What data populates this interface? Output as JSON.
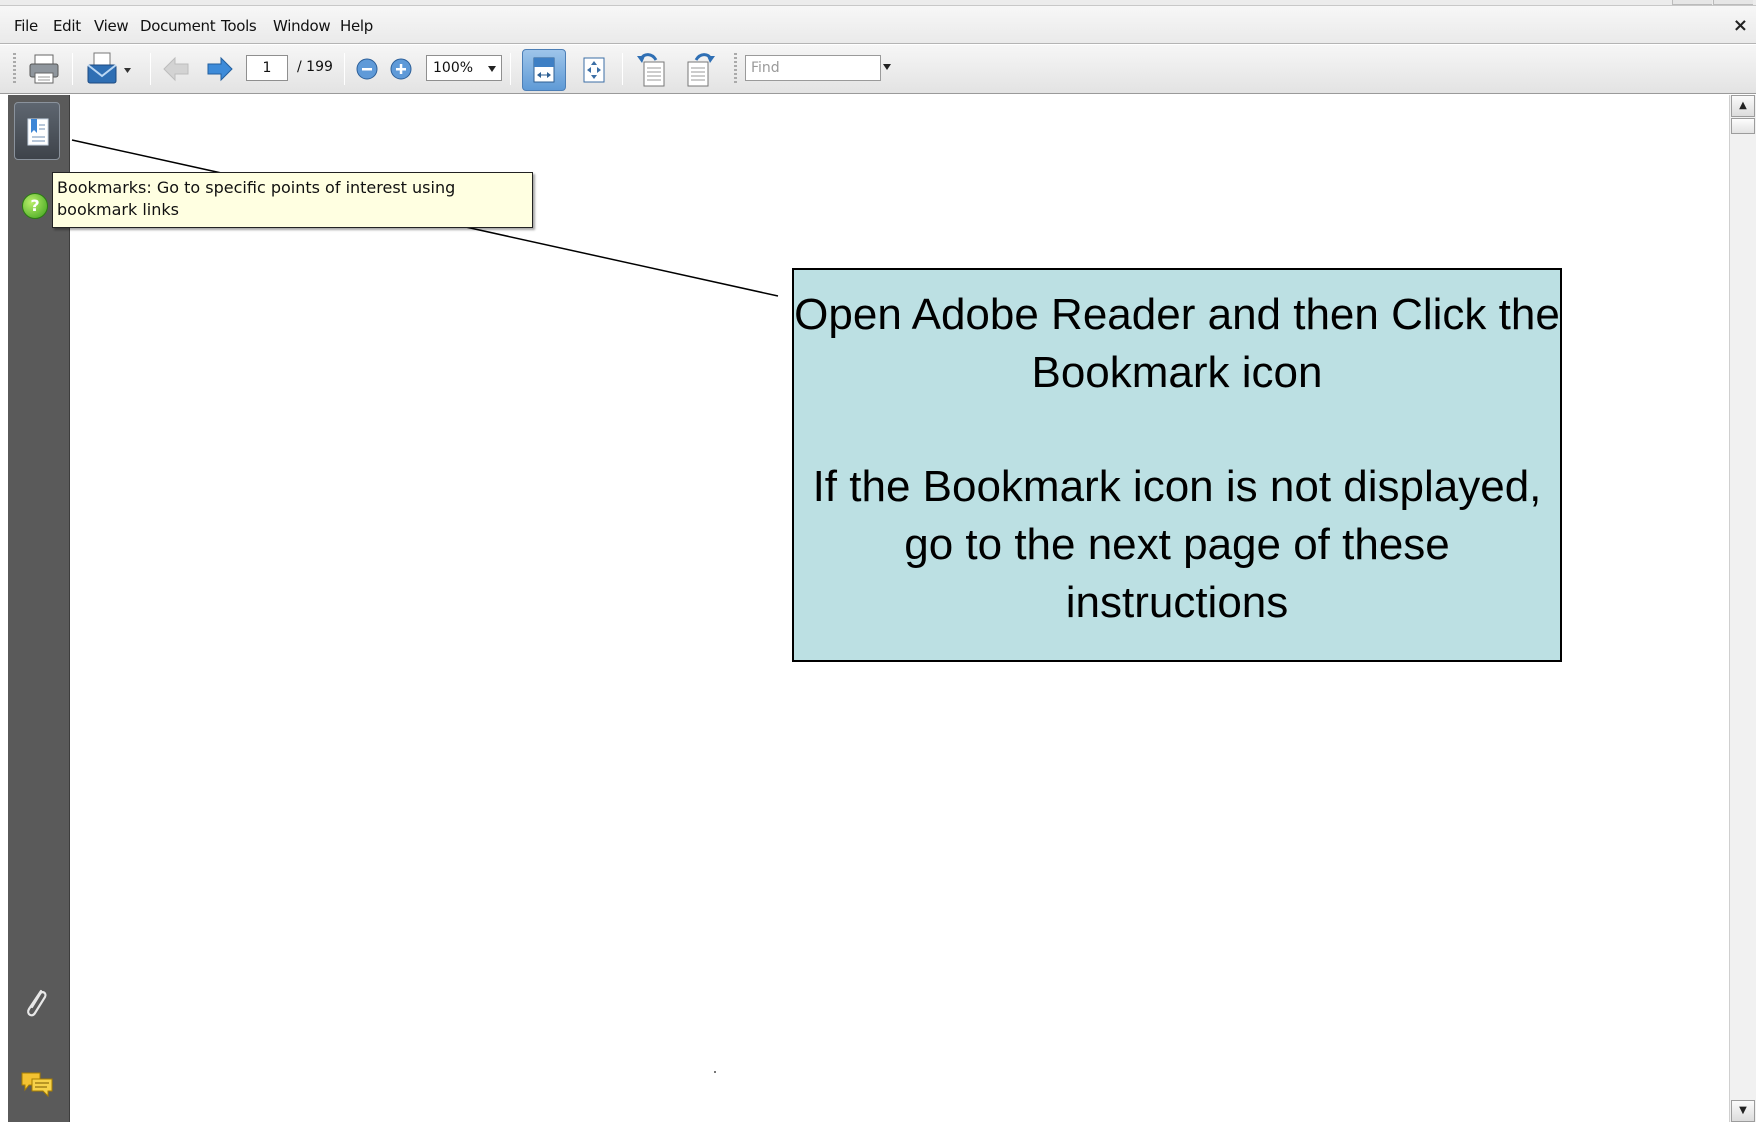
{
  "menubar": {
    "items": [
      "File",
      "Edit",
      "View",
      "Document",
      "Tools",
      "Window",
      "Help"
    ],
    "close_glyph": "×"
  },
  "toolbar": {
    "icons": [
      "print-icon",
      "email-icon",
      "previous-page-icon",
      "next-page-icon",
      "zoom-out-icon",
      "zoom-in-icon",
      "fit-width-icon",
      "fit-page-icon",
      "rotate-ccw-icon",
      "rotate-cw-icon"
    ],
    "current_page": "1",
    "total_pages": "/ 199",
    "zoom": "100%",
    "find_placeholder": "Find"
  },
  "navpanel": {
    "icons": [
      "bookmarks-icon",
      "help-icon",
      "attachments-icon",
      "comments-icon"
    ],
    "help_glyph": "?"
  },
  "tooltip": {
    "text": "Bookmarks: Go to specific points of interest using bookmark links"
  },
  "callout": {
    "paragraph1": "Open Adobe Reader and then Click the Bookmark icon",
    "paragraph2": "If the Bookmark icon is not displayed, go to the next page of these instructions"
  },
  "scrollbar": {
    "up_glyph": "▲",
    "down_glyph": "▼"
  },
  "colors": {
    "nav_panel": "#5a5a5a",
    "tooltip_bg": "#ffffe1",
    "callout_bg": "#bce0e3",
    "active_toolbar_button": "#6fa5dc"
  }
}
